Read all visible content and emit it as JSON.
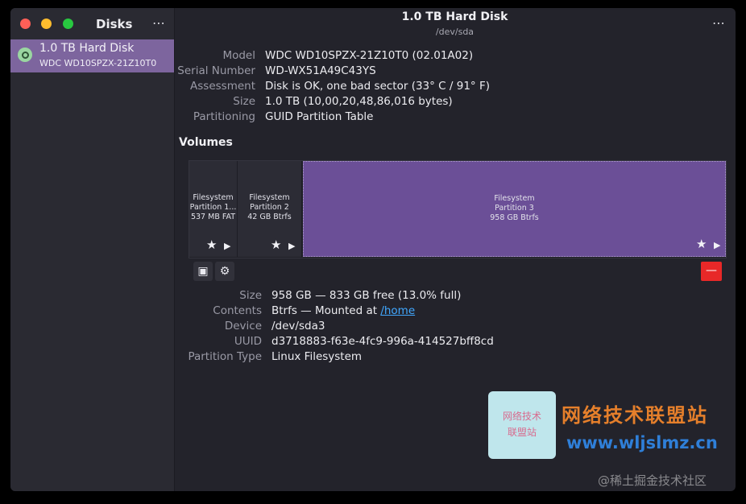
{
  "sidebar": {
    "title": "Disks",
    "menu": "⋯",
    "disks": [
      {
        "name": "1.0 TB Hard Disk",
        "model": "WDC WD10SPZX-21Z10T0",
        "selected": true,
        "icon": "disk-drive-icon"
      }
    ]
  },
  "header": {
    "title": "1.0 TB Hard Disk",
    "subtitle": "/dev/sda",
    "menu": "⋯"
  },
  "disk_props": [
    {
      "label": "Model",
      "value": "WDC WD10SPZX-21Z10T0 (02.01A02)"
    },
    {
      "label": "Serial Number",
      "value": "WD-WX51A49C43YS"
    },
    {
      "label": "Assessment",
      "value": "Disk is OK, one bad sector (33° C / 91° F)"
    },
    {
      "label": "Size",
      "value": "1.0 TB (10,00,20,48,86,016 bytes)"
    },
    {
      "label": "Partitioning",
      "value": "GUID Partition Table"
    }
  ],
  "volumes": {
    "heading": "Volumes",
    "partitions": [
      {
        "type": "Filesystem",
        "name": "Partition 1...",
        "size": "537 MB FAT",
        "selected": false
      },
      {
        "type": "Filesystem",
        "name": "Partition 2",
        "size": "42 GB Btrfs",
        "selected": false
      },
      {
        "type": "Filesystem",
        "name": "Partition 3",
        "size": "958 GB Btrfs",
        "selected": true
      }
    ],
    "star_glyph": "★",
    "play_glyph": "▶",
    "stop_glyph": "▣",
    "gear_glyph": "⚙",
    "remove_glyph": "—"
  },
  "partition_props": {
    "size": {
      "label": "Size",
      "value": "958 GB — 833 GB free (13.0% full)"
    },
    "contents": {
      "label": "Contents",
      "value": "Btrfs — Mounted at ",
      "link": "/home"
    },
    "device": {
      "label": "Device",
      "value": "/dev/sda3"
    },
    "uuid": {
      "label": "UUID",
      "value": "d3718883-f63e-4fc9-996a-414527bff8cd"
    },
    "ptype": {
      "label": "Partition Type",
      "value": "Linux Filesystem"
    }
  },
  "watermark": {
    "box_line1": "网络技术",
    "box_line2": "联盟站",
    "big": "网络技术联盟站",
    "url": "www.wljslmz.cn",
    "corner": "@稀土掘金技术社区"
  }
}
